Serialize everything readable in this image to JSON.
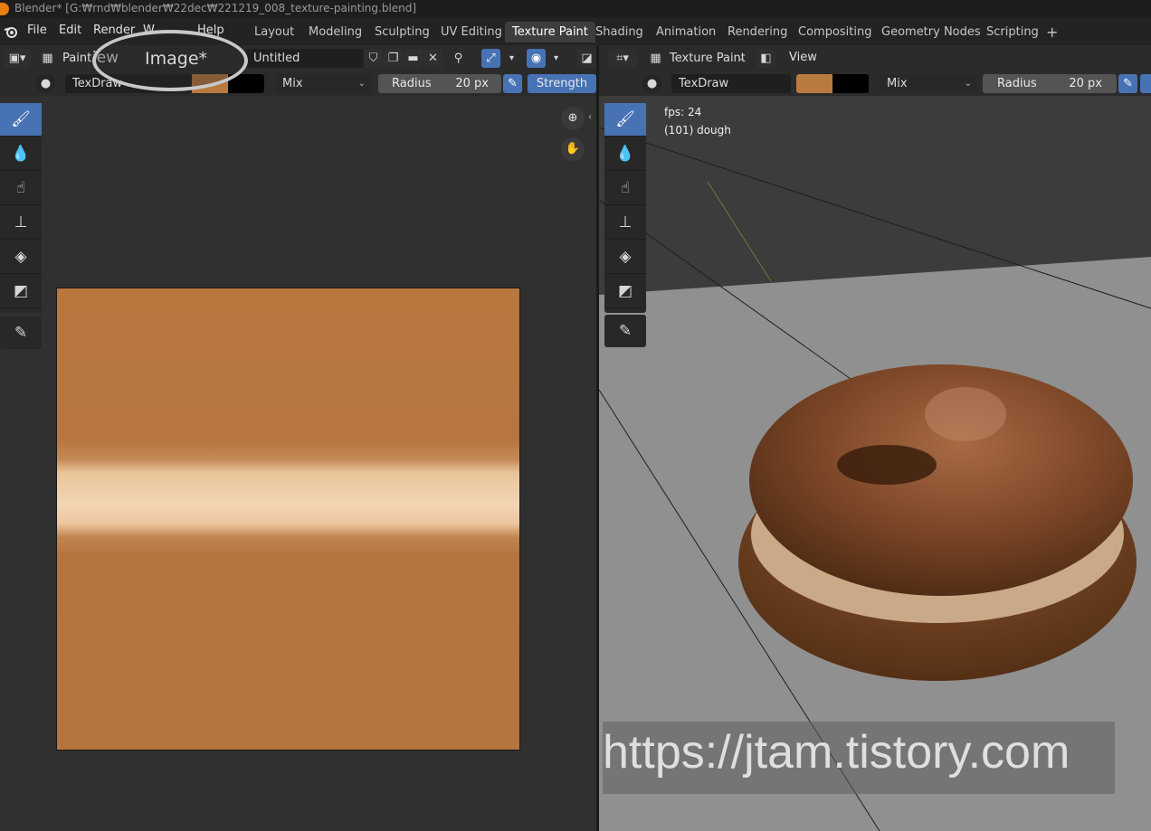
{
  "window": {
    "title": "Blender* [G:₩rnd₩blender₩22dec₩221219_008_texture-painting.blend]"
  },
  "menubar": {
    "file": "File",
    "edit": "Edit",
    "render": "Render",
    "window": "W",
    "help": "Help"
  },
  "workspaces": [
    {
      "label": "Layout"
    },
    {
      "label": "Modeling"
    },
    {
      "label": "Sculpting"
    },
    {
      "label": "UV Editing"
    },
    {
      "label": "Texture Paint"
    },
    {
      "label": "Shading"
    },
    {
      "label": "Animation"
    },
    {
      "label": "Rendering"
    },
    {
      "label": "Compositing"
    },
    {
      "label": "Geometry Nodes"
    },
    {
      "label": "Scripting"
    }
  ],
  "image_editor": {
    "mode_label": "Paint",
    "view_menu": "iew",
    "image_menu": "Image*",
    "image_name": "Untitled",
    "brush_name": "TexDraw",
    "blend_mode": "Mix",
    "radius_label": "Radius",
    "radius_value": "20 px",
    "strength_label": "Strength",
    "color_primary": "#b87a3f",
    "color_secondary": "#000000"
  },
  "viewport": {
    "mode_label": "Texture Paint",
    "view_menu": "View",
    "brush_name": "TexDraw",
    "blend_mode": "Mix",
    "radius_label": "Radius",
    "radius_value": "20 px",
    "fps_text": "fps: 24",
    "object_text": "(101) dough",
    "color_primary": "#b87a3f",
    "color_secondary": "#000000"
  },
  "tools": [
    "draw-brush",
    "soften",
    "smear",
    "clone",
    "fill",
    "mask",
    "annotate"
  ],
  "watermark": "https://jtam.tistory.com",
  "accent_color": "#4772b3"
}
